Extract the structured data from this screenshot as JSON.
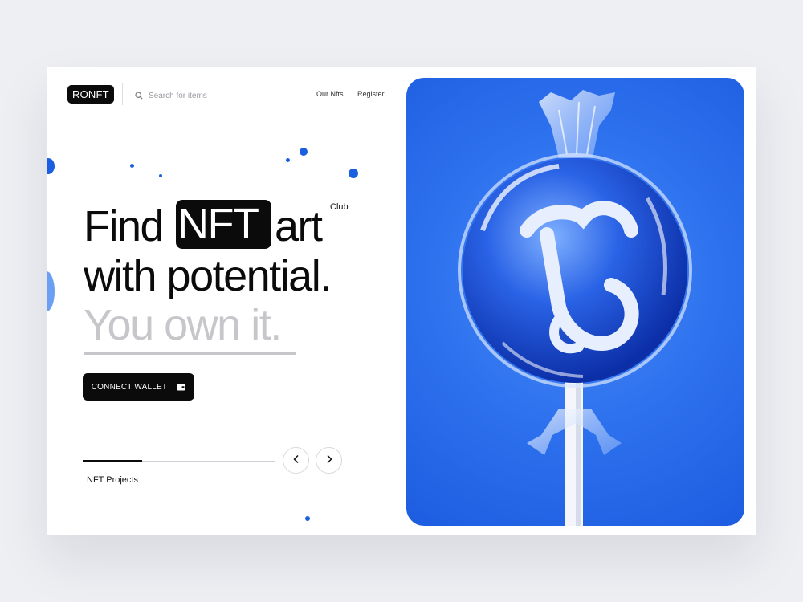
{
  "header": {
    "logo": "RONFT",
    "search_placeholder": "Search for items",
    "nav": [
      "Our Nfts",
      "Register"
    ]
  },
  "hero": {
    "line1_before": "Find",
    "line1_highlight": "NFT",
    "line1_after": "art",
    "superscript": "Club",
    "line2": "with potential.",
    "line3": "You own it."
  },
  "cta": {
    "label": "CONNECT WALLET",
    "icon": "wallet-icon"
  },
  "projects": {
    "label": "NFT Projects",
    "progress": 0.31
  },
  "icons": {
    "search": "search-icon",
    "prev": "chevron-left-icon",
    "next": "chevron-right-icon"
  },
  "colors": {
    "accent": "#1a5fe0",
    "dark": "#0b0b0b",
    "muted": "#c7c7cb",
    "background": "#eeeff3"
  }
}
